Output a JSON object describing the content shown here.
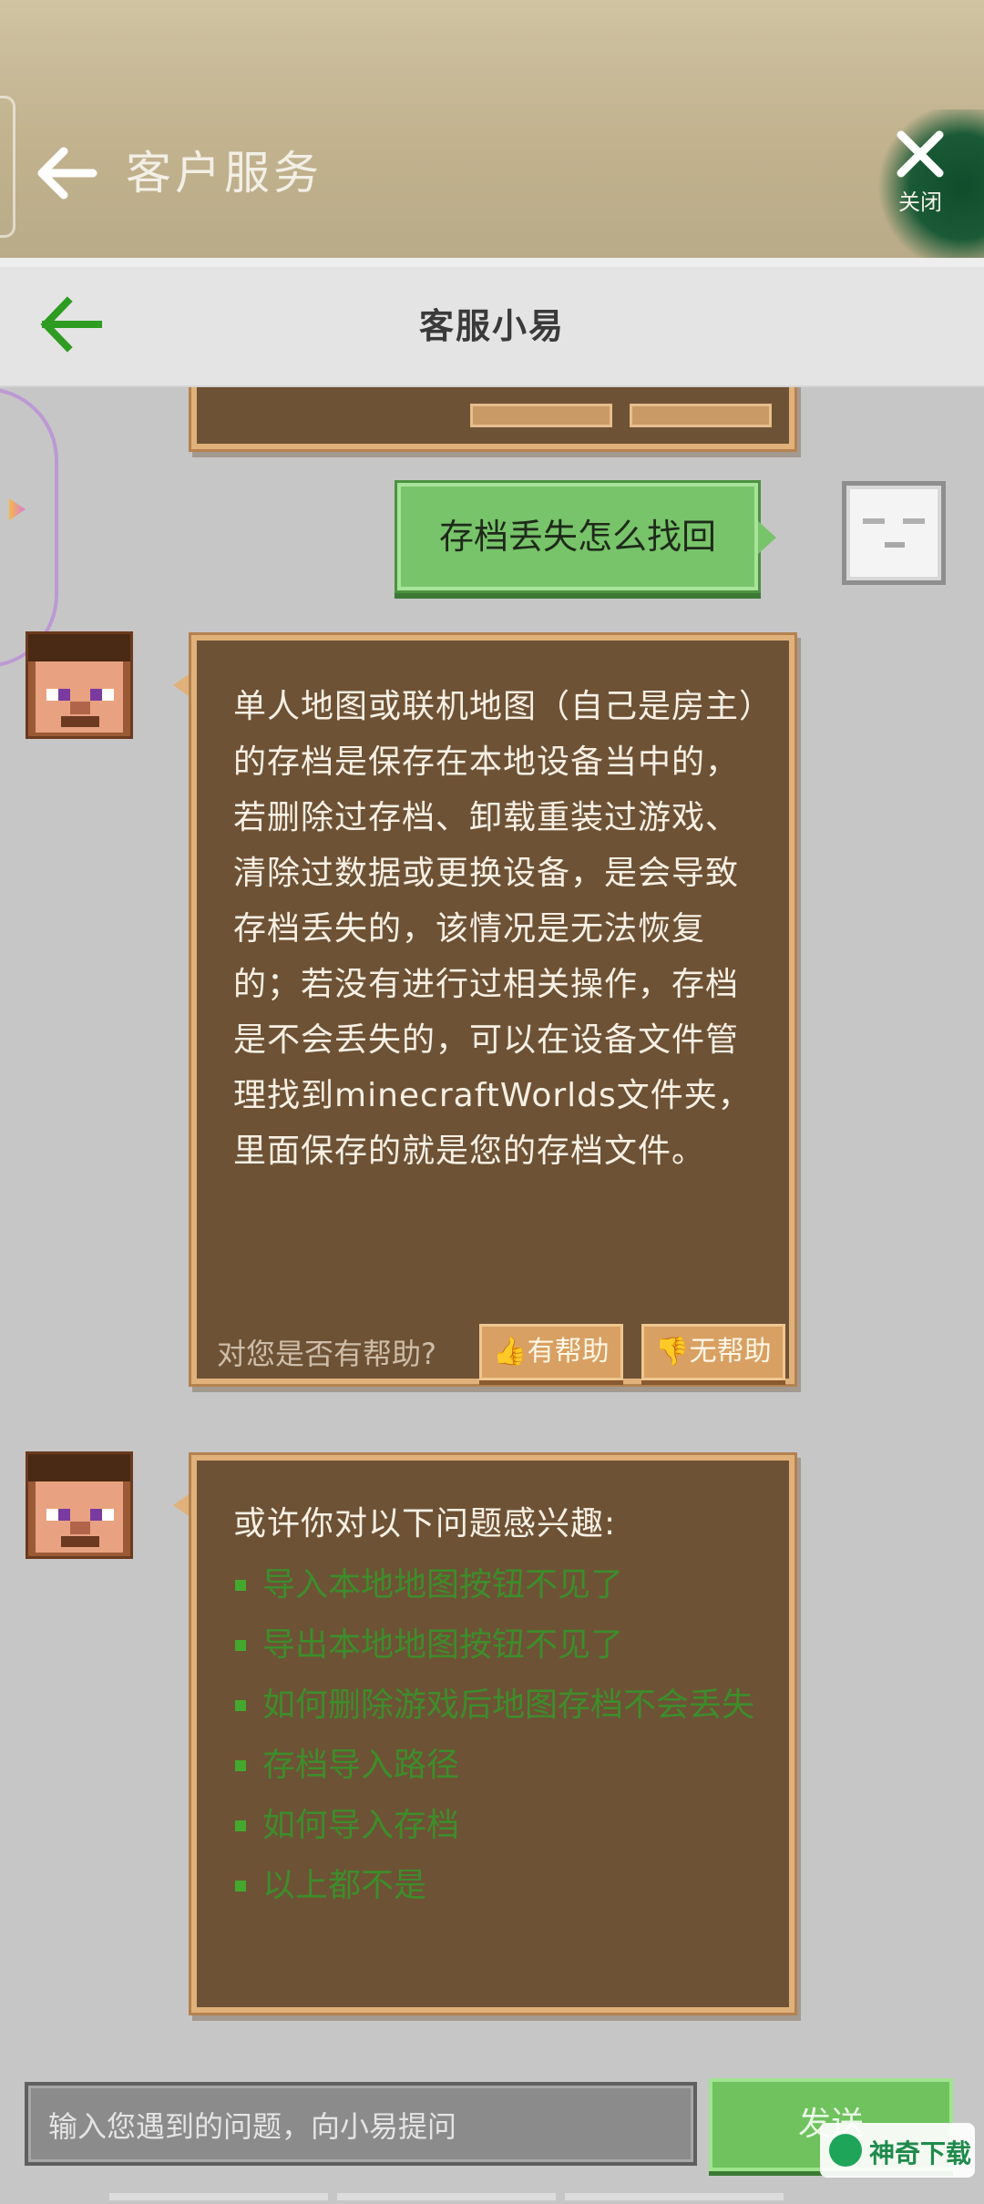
{
  "header": {
    "title": "客户服务",
    "close_label": "关闭"
  },
  "nav": {
    "title": "客服小易"
  },
  "chat": {
    "user_message": "存档丢失怎么找回",
    "answer_text": "单人地图或联机地图（自己是房主）的存档是保存在本地设备当中的，若删除过存档、卸载重装过游戏、清除过数据或更换设备，是会导致存档丢失的，该情况是无法恢复的；若没有进行过相关操作，存档是不会丢失的，可以在设备文件管理找到minecraftWorlds文件夹，里面保存的就是您的存档文件。",
    "feedback": {
      "question": "对您是否有帮助?",
      "yes": "有帮助",
      "no": "无帮助"
    },
    "suggestions": {
      "title": "或许你对以下问题感兴趣:",
      "items": [
        "导入本地地图按钮不见了",
        "导出本地地图按钮不见了",
        "如何删除游戏后地图存档不会丢失",
        "存档导入路径",
        "如何导入存档",
        "以上都不是"
      ]
    }
  },
  "input": {
    "placeholder": "输入您遇到的问题，向小易提问",
    "send_label": "发送"
  },
  "watermark": {
    "text": "神奇下载"
  },
  "colors": {
    "wood": "#6e5236",
    "wood_border": "#e0b17a",
    "user_bubble": "#78c46a",
    "link_green": "#3d8d2a"
  }
}
